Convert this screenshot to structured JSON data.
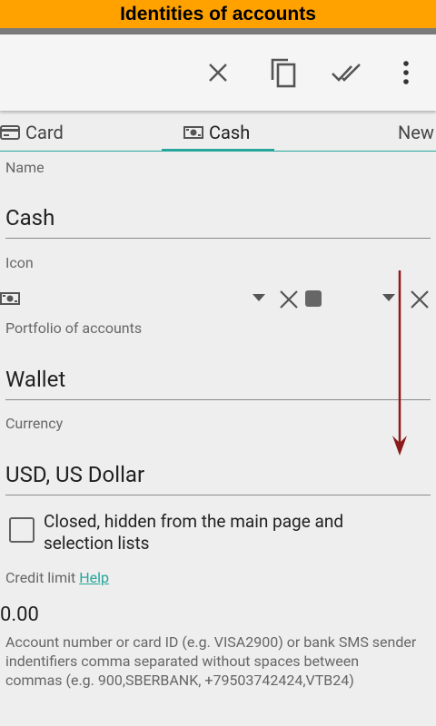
{
  "banner": {
    "title": "Identities of accounts"
  },
  "toolbar": {
    "close_icon": "close-icon",
    "copy_icon": "copy-icon",
    "done_all_icon": "done-all-icon",
    "more_icon": "more-vert-icon"
  },
  "tabs": [
    {
      "label": "Card",
      "icon": "credit-card-icon"
    },
    {
      "label": "Cash",
      "icon": "cash-icon",
      "active": true
    },
    {
      "label": "New"
    }
  ],
  "form": {
    "name_label": "Name",
    "name_value": "Cash",
    "icon_label": "Icon",
    "portfolio_label": "Portfolio of accounts",
    "portfolio_value": "Wallet",
    "currency_label": "Currency",
    "currency_value": "USD, US Dollar",
    "closed_checkbox_label": "Closed, hidden from the main page and selection lists",
    "credit_limit_label": "Credit limit",
    "help_link": "Help",
    "credit_limit_value": "0.00",
    "account_number_hint": "Account number or card ID (e.g. VISA2900) or bank SMS sender indentifiers comma separated without spaces between commas (e.g. 900,SBERBANK, +79503742424,VTB24)"
  },
  "colors": {
    "banner": "#ffa200",
    "accent": "#26a69a",
    "annotation_arrow": "#8b1a1a"
  }
}
